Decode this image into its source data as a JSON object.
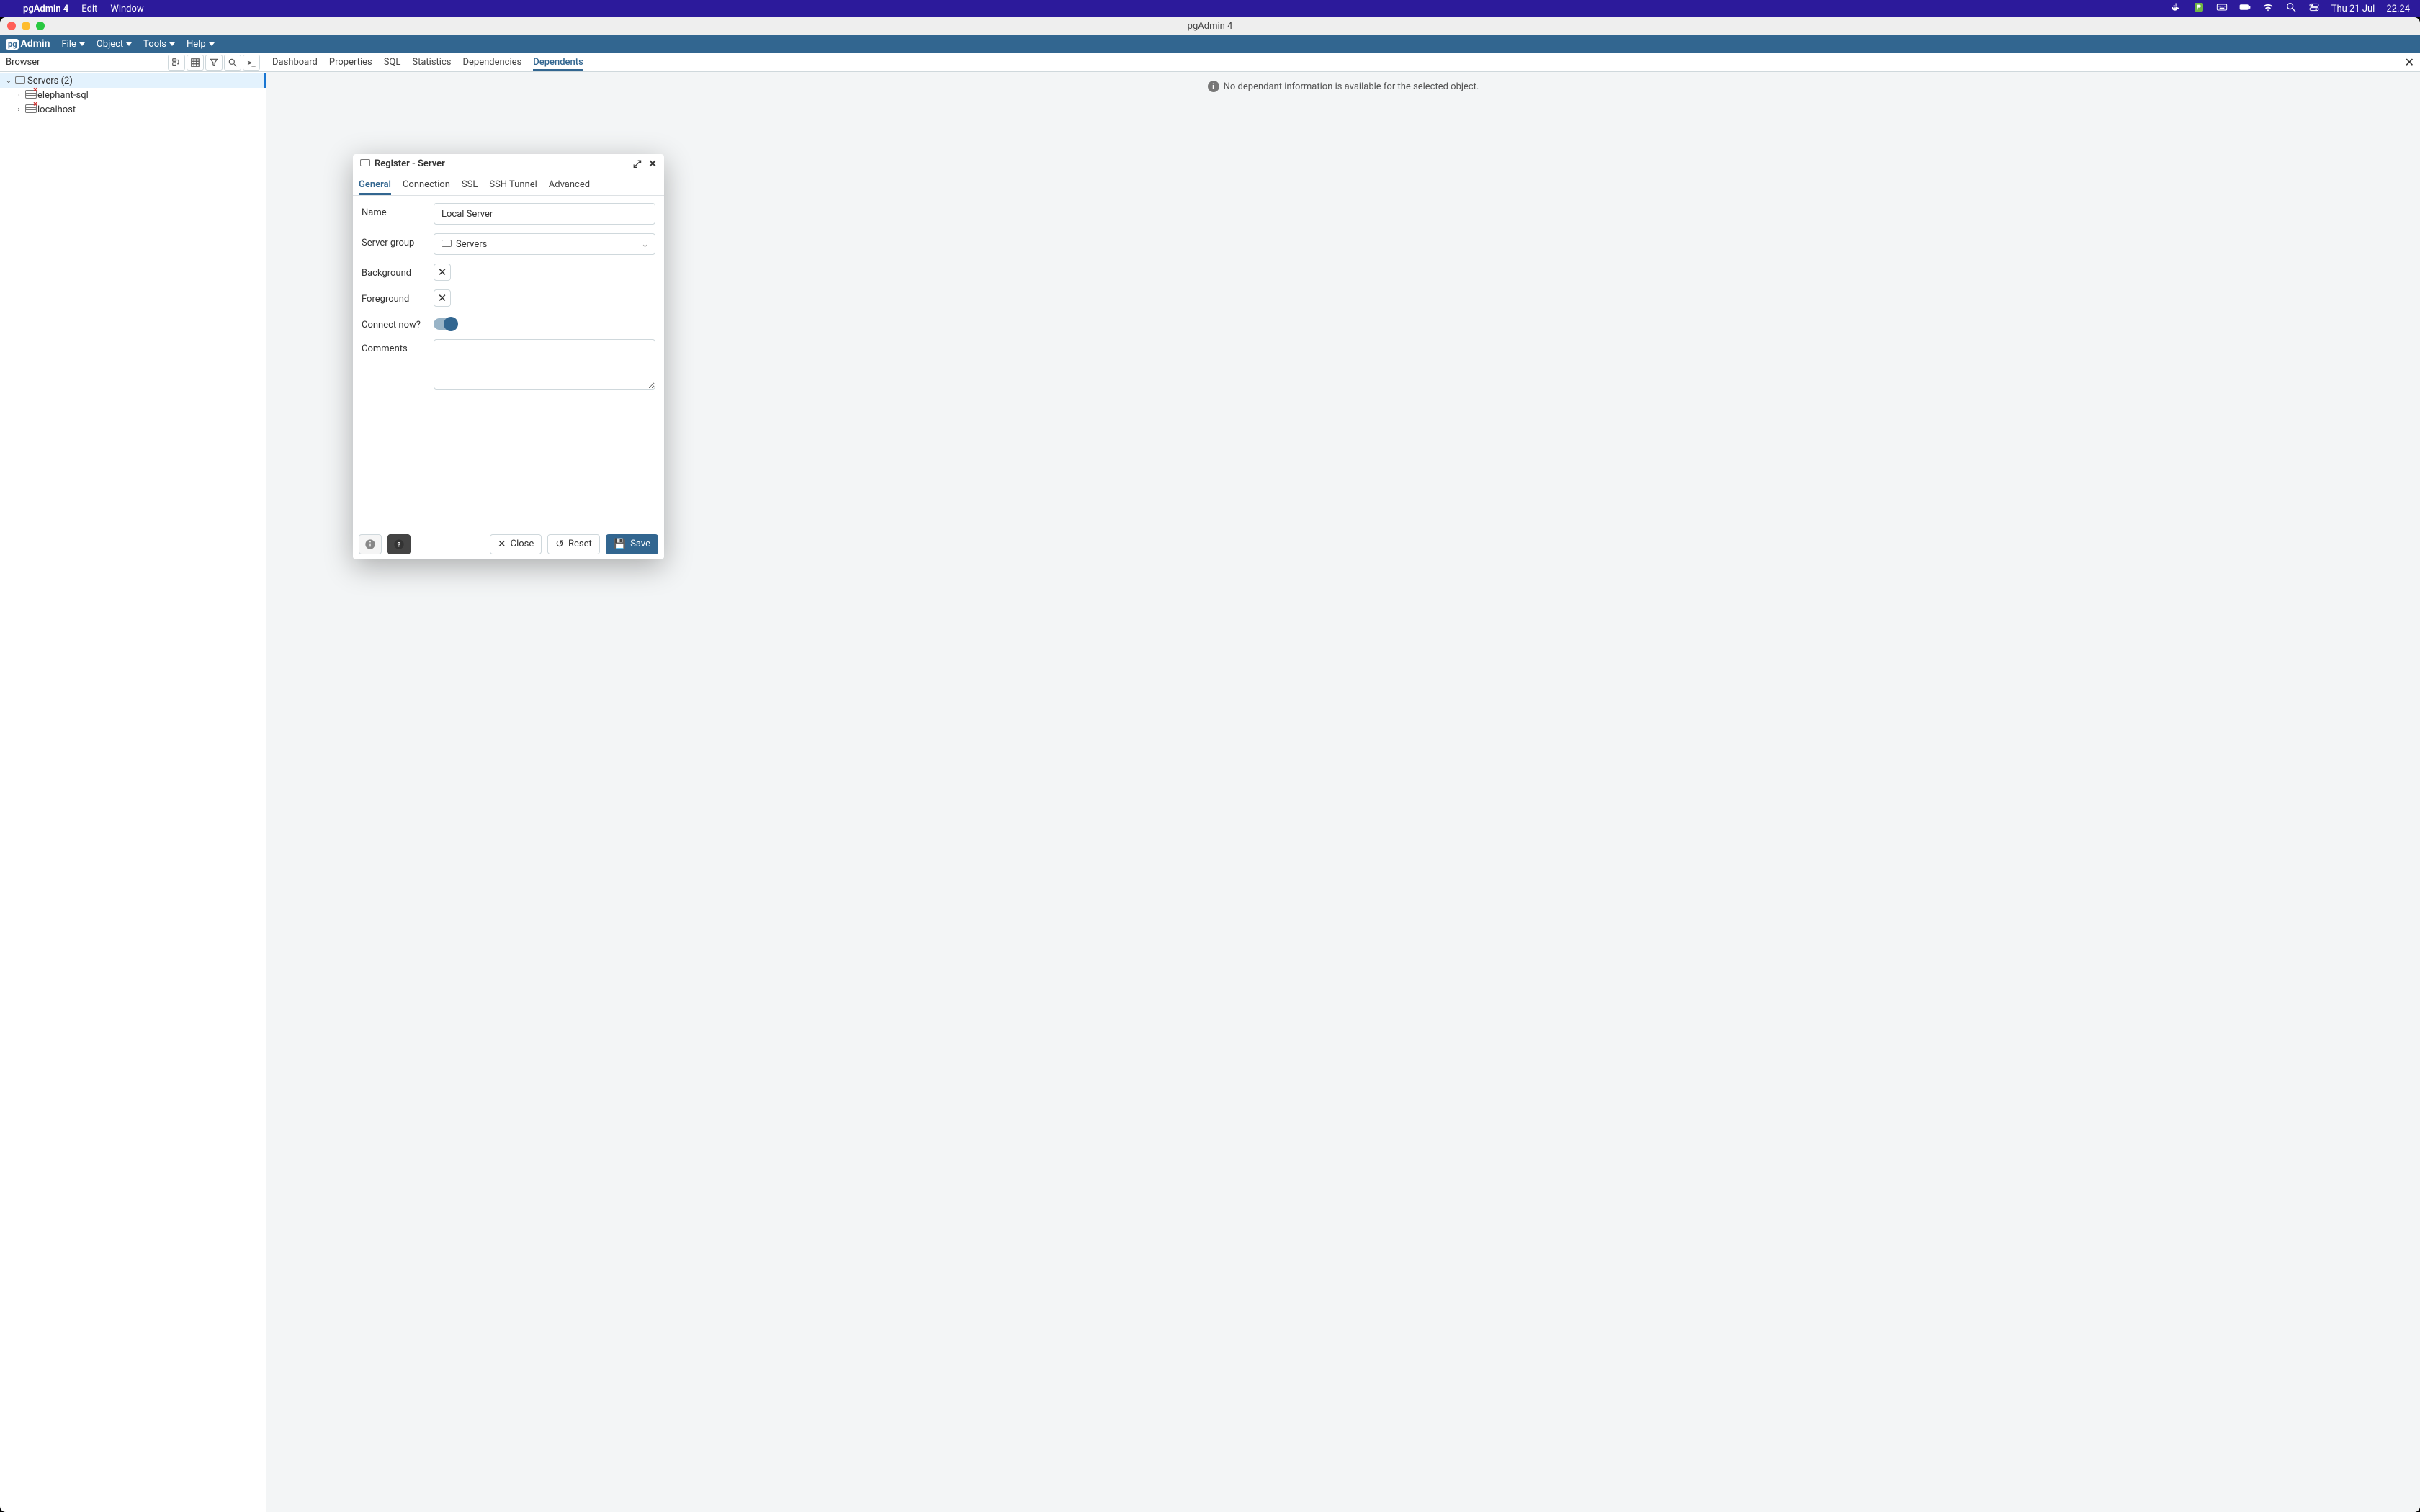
{
  "mac_menubar": {
    "app": "pgAdmin 4",
    "items": [
      "Edit",
      "Window"
    ],
    "status": {
      "date": "Thu 21 Jul",
      "time": "22.24"
    }
  },
  "window": {
    "title": "pgAdmin 4"
  },
  "app_menu": [
    "File",
    "Object",
    "Tools",
    "Help"
  ],
  "sidebar": {
    "title": "Browser",
    "root": {
      "label": "Servers (2)"
    },
    "children": [
      {
        "label": "elephant-sql"
      },
      {
        "label": "localhost"
      }
    ]
  },
  "tabs": [
    "Dashboard",
    "Properties",
    "SQL",
    "Statistics",
    "Dependencies",
    "Dependents"
  ],
  "tabs_active_index": 5,
  "main_info": "No dependant information is available for the selected object.",
  "modal": {
    "title": "Register - Server",
    "tabs": [
      "General",
      "Connection",
      "SSL",
      "SSH Tunnel",
      "Advanced"
    ],
    "tabs_active_index": 0,
    "form": {
      "name_label": "Name",
      "name_value": "Local Server",
      "group_label": "Server group",
      "group_value": "Servers",
      "background_label": "Background",
      "foreground_label": "Foreground",
      "connect_label": "Connect now?",
      "connect_on": true,
      "comments_label": "Comments",
      "comments_value": ""
    },
    "footer": {
      "close": "Close",
      "reset": "Reset",
      "save": "Save"
    }
  }
}
